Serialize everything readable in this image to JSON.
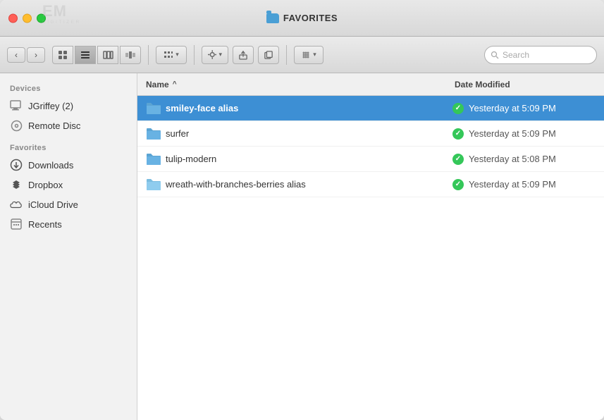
{
  "window": {
    "title": "FAVORITES",
    "title_folder_icon": "folder-icon"
  },
  "watermark": {
    "line1": "EM",
    "line2": "DIGITIZER"
  },
  "toolbar": {
    "back_label": "‹",
    "forward_label": "›",
    "view_icon": "⊞",
    "view_list": "≡",
    "view_columns": "⊟",
    "view_cover": "⊟⊟",
    "view_grid": "⊞⊞",
    "action_gear": "⚙",
    "action_share": "⬆",
    "action_copy": "⊡",
    "action_tag": "❖",
    "search_placeholder": "Search"
  },
  "sidebar": {
    "devices_header": "Devices",
    "favorites_header": "Favorites",
    "items": [
      {
        "id": "jgriffey",
        "label": "JGriffey (2)",
        "icon": "monitor-icon"
      },
      {
        "id": "remote-disc",
        "label": "Remote Disc",
        "icon": "disc-icon"
      },
      {
        "id": "downloads",
        "label": "Downloads",
        "icon": "downloads-icon"
      },
      {
        "id": "dropbox",
        "label": "Dropbox",
        "icon": "dropbox-icon"
      },
      {
        "id": "icloud",
        "label": "iCloud Drive",
        "icon": "icloud-icon"
      },
      {
        "id": "recents",
        "label": "Recents",
        "icon": "recents-icon"
      }
    ]
  },
  "columns": {
    "name": "Name",
    "sort_indicator": "^",
    "date_modified": "Date Modified"
  },
  "files": [
    {
      "id": "smiley-face-alias",
      "name": "smiley-face alias",
      "date": "Yesterday at 5:09 PM",
      "status": "check",
      "selected": true
    },
    {
      "id": "surfer",
      "name": "surfer",
      "date": "Yesterday at 5:09 PM",
      "status": "check",
      "selected": false
    },
    {
      "id": "tulip-modern",
      "name": "tulip-modern",
      "date": "Yesterday at 5:08 PM",
      "status": "check",
      "selected": false
    },
    {
      "id": "wreath-with-branches-berries-alias",
      "name": "wreath-with-branches-berries alias",
      "date": "Yesterday at 5:09 PM",
      "status": "check",
      "selected": false
    }
  ]
}
